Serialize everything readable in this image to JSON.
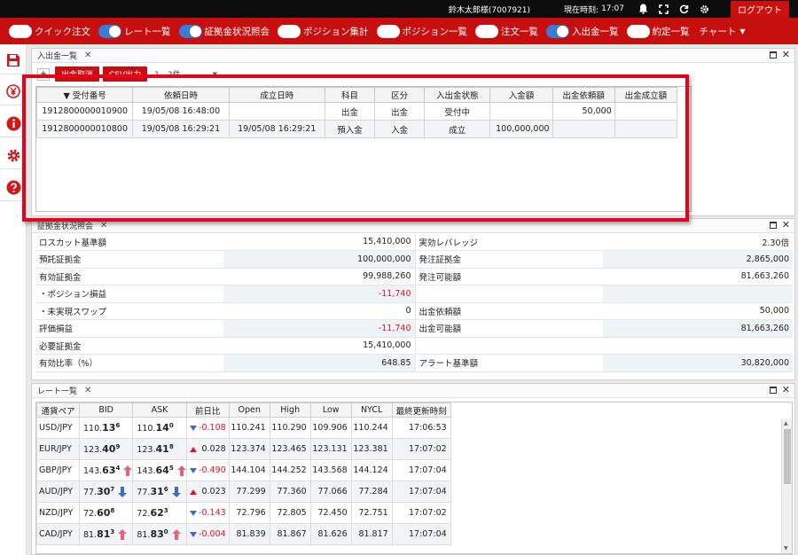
{
  "topbar": {
    "user": "鈴木太郎様(7007921)",
    "clock_label": "現在時刻:",
    "clock_time": "17:07",
    "logout": "ログアウト"
  },
  "toggles": [
    {
      "label": "クイック注文",
      "on": false
    },
    {
      "label": "レート一覧",
      "on": true
    },
    {
      "label": "証拠金状況照会",
      "on": true
    },
    {
      "label": "ポジション集計",
      "on": false
    },
    {
      "label": "ポジション一覧",
      "on": false
    },
    {
      "label": "注文一覧",
      "on": false
    },
    {
      "label": "入出金一覧",
      "on": true
    },
    {
      "label": "約定一覧",
      "on": false
    }
  ],
  "chart_menu": "チャート",
  "transfer_panel": {
    "title": "入出金一覧",
    "btn_plus": "+",
    "btn_withdraw": "出金取消",
    "btn_csv": "CSV出力",
    "count": "1 - 2件",
    "headers": [
      "▼ 受付番号",
      "依頼日時",
      "成立日時",
      "科目",
      "区分",
      "入出金状態",
      "入金額",
      "出金依頼額",
      "出金成立額"
    ],
    "rows": [
      [
        "1912800000010900",
        "19/05/08 16:48:00",
        "",
        "出金",
        "出金",
        "受付中",
        "",
        "50,000",
        ""
      ],
      [
        "1912800000010800",
        "19/05/08 16:29:21",
        "19/05/08 16:29:21",
        "預入金",
        "入金",
        "成立",
        "100,000,000",
        "",
        ""
      ]
    ]
  },
  "margin_panel": {
    "title": "証拠金状況照会",
    "rows": [
      [
        "ロスカット基準額",
        "15,410,000",
        "実効レバレッジ",
        "2.30倍"
      ],
      [
        "預託証拠金",
        "100,000,000",
        "発注証拠金",
        "2,865,000"
      ],
      [
        "有効証拠金",
        "99,988,260",
        "発注可能額",
        "81,663,260"
      ],
      [
        "・ポジション損益",
        "-11,740",
        "",
        ""
      ],
      [
        "・未実現スワップ",
        "0",
        "出金依頼額",
        "50,000"
      ],
      [
        "評価損益",
        "-11,740",
        "出金可能額",
        "81,663,260"
      ],
      [
        "必要証拠金",
        "15,410,000",
        "",
        ""
      ],
      [
        "有効比率（%）",
        "648.85",
        "アラート基準額",
        "30,820,000"
      ]
    ]
  },
  "rate_panel": {
    "title": "レート一覧",
    "headers": [
      "通貨ペア",
      "BID",
      "ASK",
      "前日比",
      "Open",
      "High",
      "Low",
      "NYCL",
      "最終更新時刻"
    ],
    "rows": [
      {
        "pair": "USD/JPY",
        "bid_a": "110.",
        "bid_b": "13",
        "bid_c": "6",
        "bid_dir": "",
        "ask_a": "110.",
        "ask_b": "14",
        "ask_c": "0",
        "ask_dir": "",
        "chg_dir": "down",
        "chg": "-0.108",
        "open": "110.241",
        "high": "110.290",
        "low": "109.906",
        "nycl": "110.244",
        "time": "17:06:53"
      },
      {
        "pair": "EUR/JPY",
        "bid_a": "123.",
        "bid_b": "40",
        "bid_c": "9",
        "bid_dir": "",
        "ask_a": "123.",
        "ask_b": "41",
        "ask_c": "8",
        "ask_dir": "",
        "chg_dir": "up",
        "chg": "0.028",
        "open": "123.374",
        "high": "123.465",
        "low": "123.131",
        "nycl": "123.381",
        "time": "17:07:02"
      },
      {
        "pair": "GBP/JPY",
        "bid_a": "143.",
        "bid_b": "63",
        "bid_c": "4",
        "bid_dir": "up",
        "ask_a": "143.",
        "ask_b": "64",
        "ask_c": "5",
        "ask_dir": "up",
        "chg_dir": "down",
        "chg": "-0.490",
        "open": "144.104",
        "high": "144.252",
        "low": "143.568",
        "nycl": "144.124",
        "time": "17:07:04"
      },
      {
        "pair": "AUD/JPY",
        "bid_a": "77.",
        "bid_b": "30",
        "bid_c": "7",
        "bid_dir": "down",
        "ask_a": "77.",
        "ask_b": "31",
        "ask_c": "6",
        "ask_dir": "down",
        "chg_dir": "up",
        "chg": "0.023",
        "open": "77.299",
        "high": "77.360",
        "low": "77.066",
        "nycl": "77.284",
        "time": "17:07:04"
      },
      {
        "pair": "NZD/JPY",
        "bid_a": "72.",
        "bid_b": "60",
        "bid_c": "8",
        "bid_dir": "",
        "ask_a": "72.",
        "ask_b": "62",
        "ask_c": "3",
        "ask_dir": "",
        "chg_dir": "down",
        "chg": "-0.143",
        "open": "72.796",
        "high": "72.805",
        "low": "72.450",
        "nycl": "72.751",
        "time": "17:07:02"
      },
      {
        "pair": "CAD/JPY",
        "bid_a": "81.",
        "bid_b": "81",
        "bid_c": "3",
        "bid_dir": "up",
        "ask_a": "81.",
        "ask_b": "83",
        "ask_c": "0",
        "ask_dir": "up",
        "chg_dir": "down",
        "chg": "-0.004",
        "open": "81.839",
        "high": "81.867",
        "low": "81.626",
        "nycl": "81.817",
        "time": "17:07:04"
      }
    ]
  },
  "colors": {
    "brand_red": "#c80f0f",
    "toggle_on": "#3a7bd5",
    "negative": "#e8101e",
    "up_arrow": "#e8607a",
    "down_arrow": "#3f6cc0",
    "highlight_border": "#e8001c"
  },
  "icons": {
    "rail": [
      "save-icon",
      "yen-icon",
      "info-icon",
      "gear-icon",
      "help-icon"
    ],
    "topbar": [
      "bell-icon",
      "fullscreen-icon",
      "refresh-icon",
      "gear-icon"
    ]
  }
}
